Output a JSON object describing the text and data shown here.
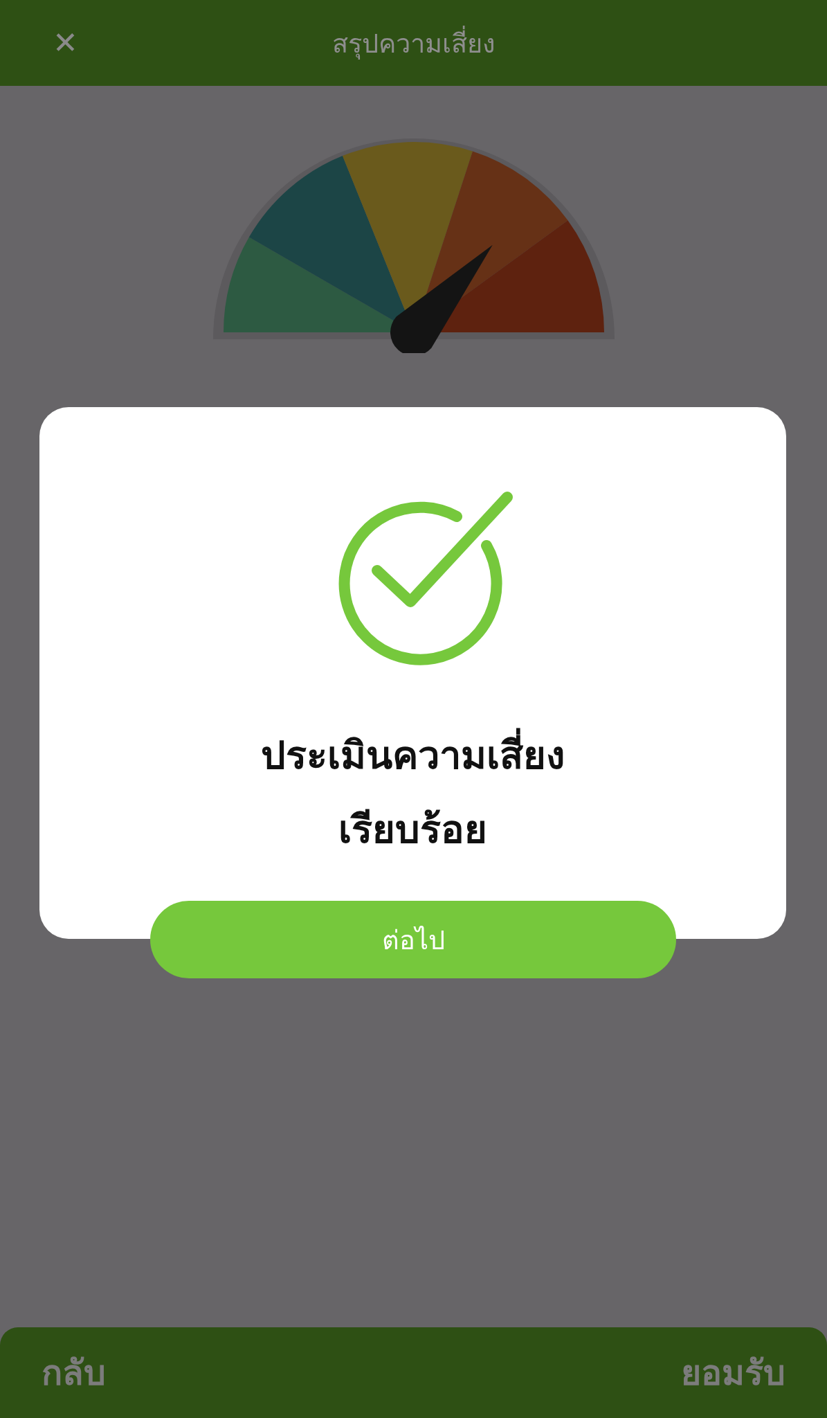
{
  "header": {
    "close": "✕",
    "title": "สรุปความเสี่ยง"
  },
  "dialog": {
    "message_lines": [
      "ประเมินความเสี่ยง",
      "เรียบร้อย"
    ],
    "button": "ต่อไป"
  },
  "footer": {
    "back": "กลับ",
    "accept": "ยอมรับ"
  }
}
